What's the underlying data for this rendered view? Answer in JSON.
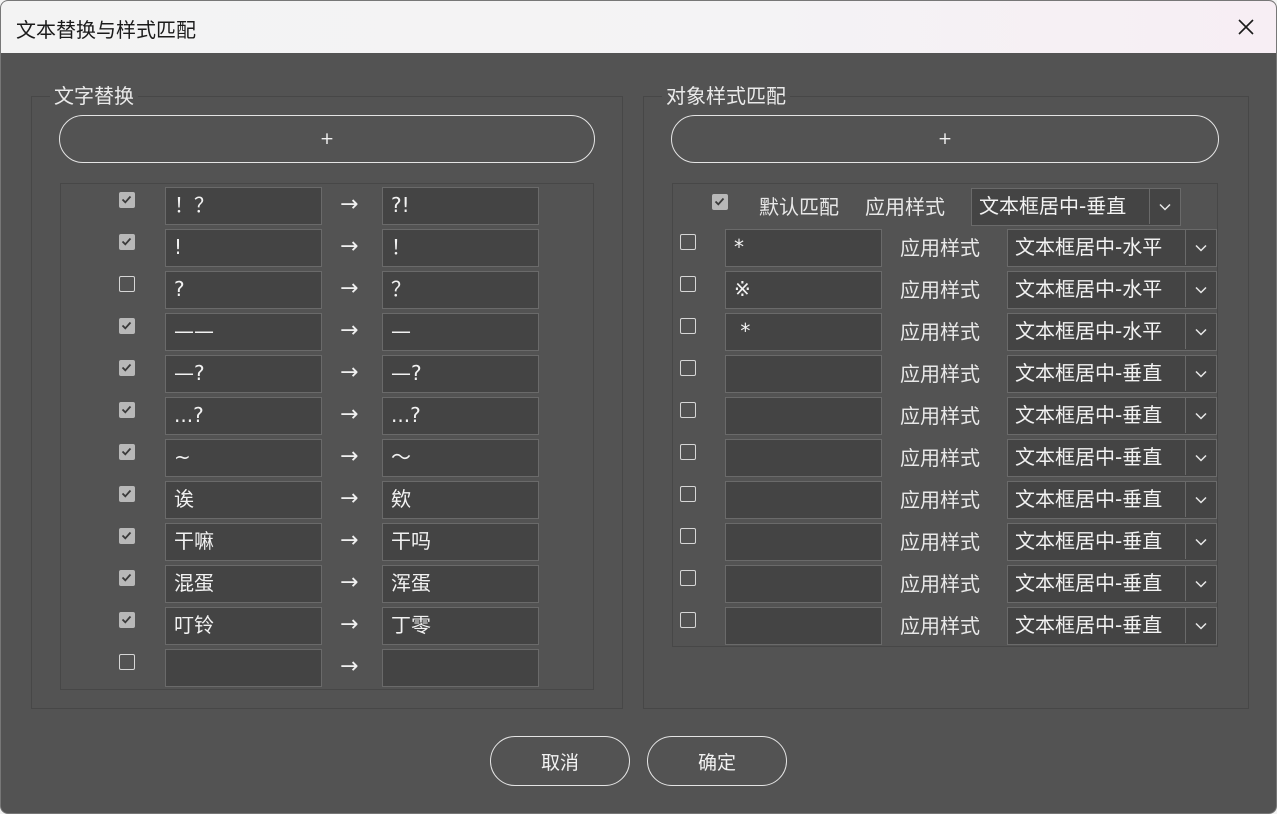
{
  "window": {
    "title": "文本替换与样式匹配"
  },
  "text_replace": {
    "group_label": "文字替换",
    "add_label": "+",
    "arrow": "→",
    "rows": [
      {
        "checked": true,
        "from": "！？",
        "to": "?!"
      },
      {
        "checked": true,
        "from": "!",
        "to": "！"
      },
      {
        "checked": false,
        "from": "?",
        "to": "？"
      },
      {
        "checked": true,
        "from": "——",
        "to": "—"
      },
      {
        "checked": true,
        "from": "—?",
        "to": "—?"
      },
      {
        "checked": true,
        "from": "...?",
        "to": "...?"
      },
      {
        "checked": true,
        "from": "~",
        "to": "～"
      },
      {
        "checked": true,
        "from": "诶",
        "to": "欸"
      },
      {
        "checked": true,
        "from": "干嘛",
        "to": "干吗"
      },
      {
        "checked": true,
        "from": "混蛋",
        "to": "浑蛋"
      },
      {
        "checked": true,
        "from": "叮铃",
        "to": "丁零"
      },
      {
        "checked": false,
        "from": "",
        "to": ""
      }
    ]
  },
  "style_match": {
    "group_label": "对象样式匹配",
    "add_label": "+",
    "default_row": {
      "checked": true,
      "label": "默认匹配",
      "apply_label": "应用样式",
      "style": "文本框居中-垂直"
    },
    "apply_label": "应用样式",
    "rows": [
      {
        "checked": false,
        "pattern": "*",
        "style": "文本框居中-水平"
      },
      {
        "checked": false,
        "pattern": "※",
        "style": "文本框居中-水平"
      },
      {
        "checked": false,
        "pattern": " *",
        "style": "文本框居中-水平"
      },
      {
        "checked": false,
        "pattern": "",
        "style": "文本框居中-垂直"
      },
      {
        "checked": false,
        "pattern": "",
        "style": "文本框居中-垂直"
      },
      {
        "checked": false,
        "pattern": "",
        "style": "文本框居中-垂直"
      },
      {
        "checked": false,
        "pattern": "",
        "style": "文本框居中-垂直"
      },
      {
        "checked": false,
        "pattern": "",
        "style": "文本框居中-垂直"
      },
      {
        "checked": false,
        "pattern": "",
        "style": "文本框居中-垂直"
      },
      {
        "checked": false,
        "pattern": "",
        "style": "文本框居中-垂直"
      }
    ]
  },
  "footer": {
    "cancel_label": "取消",
    "ok_label": "确定"
  },
  "colors": {
    "dialog_bg": "#535353",
    "field_bg": "#444444",
    "checkbox_checked": "#b8b8b8"
  }
}
